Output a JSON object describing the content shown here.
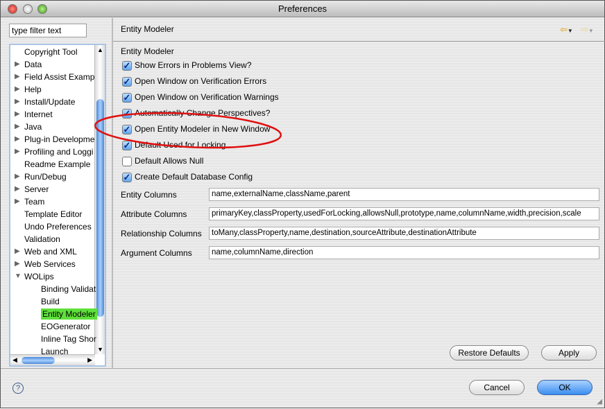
{
  "window": {
    "title": "Preferences"
  },
  "filter": {
    "placeholder": "type filter text"
  },
  "tree": [
    {
      "label": "Copyright Tool",
      "expander": "none",
      "level": 0
    },
    {
      "label": "Data",
      "expander": "collapsed",
      "level": 0
    },
    {
      "label": "Field Assist Examp",
      "expander": "collapsed",
      "level": 0
    },
    {
      "label": "Help",
      "expander": "collapsed",
      "level": 0
    },
    {
      "label": "Install/Update",
      "expander": "collapsed",
      "level": 0
    },
    {
      "label": "Internet",
      "expander": "collapsed",
      "level": 0
    },
    {
      "label": "Java",
      "expander": "collapsed",
      "level": 0
    },
    {
      "label": "Plug-in Developme",
      "expander": "collapsed",
      "level": 0
    },
    {
      "label": "Profiling and Loggi",
      "expander": "collapsed",
      "level": 0
    },
    {
      "label": "Readme Example",
      "expander": "none",
      "level": 0
    },
    {
      "label": "Run/Debug",
      "expander": "collapsed",
      "level": 0
    },
    {
      "label": "Server",
      "expander": "collapsed",
      "level": 0
    },
    {
      "label": "Team",
      "expander": "collapsed",
      "level": 0
    },
    {
      "label": "Template Editor",
      "expander": "none",
      "level": 0
    },
    {
      "label": "Undo Preferences",
      "expander": "none",
      "level": 0
    },
    {
      "label": "Validation",
      "expander": "none",
      "level": 0
    },
    {
      "label": "Web and XML",
      "expander": "collapsed",
      "level": 0
    },
    {
      "label": "Web Services",
      "expander": "collapsed",
      "level": 0
    },
    {
      "label": "WOLips",
      "expander": "expanded",
      "level": 0
    },
    {
      "label": "Binding Validat",
      "expander": "none",
      "level": 1
    },
    {
      "label": "Build",
      "expander": "none",
      "level": 1
    },
    {
      "label": "Entity Modeler",
      "expander": "none",
      "level": 1,
      "selected": true
    },
    {
      "label": "EOGenerator",
      "expander": "none",
      "level": 1
    },
    {
      "label": "Inline Tag Shor",
      "expander": "none",
      "level": 1
    },
    {
      "label": "Launch",
      "expander": "none",
      "level": 1
    }
  ],
  "page": {
    "title": "Entity Modeler",
    "group": "Entity Modeler",
    "checkboxes": [
      {
        "label": "Show Errors in Problems View?",
        "checked": true
      },
      {
        "label": "Open Window on Verification Errors",
        "checked": true
      },
      {
        "label": "Open Window on Verification Warnings",
        "checked": true
      },
      {
        "label": "Automatically Change Perspectives?",
        "checked": true
      },
      {
        "label": "Open Entity Modeler in New Window",
        "checked": true
      },
      {
        "label": "Default Used for Locking",
        "checked": true
      },
      {
        "label": "Default Allows Null",
        "checked": false
      },
      {
        "label": "Create Default Database Config",
        "checked": true
      }
    ],
    "fields": [
      {
        "label": "Entity Columns",
        "value": "name,externalName,className,parent"
      },
      {
        "label": "Attribute Columns",
        "value": "primaryKey,classProperty,usedForLocking,allowsNull,prototype,name,columnName,width,precision,scale"
      },
      {
        "label": "Relationship Columns",
        "value": "toMany,classProperty,name,destination,sourceAttribute,destinationAttribute"
      },
      {
        "label": "Argument Columns",
        "value": "name,columnName,direction"
      }
    ],
    "restore_label": "Restore Defaults",
    "apply_label": "Apply"
  },
  "footer": {
    "cancel_label": "Cancel",
    "ok_label": "OK"
  },
  "colors": {
    "selection": "#5ee03a",
    "annotation": "#e01010",
    "default_button": "#3b8df0"
  }
}
